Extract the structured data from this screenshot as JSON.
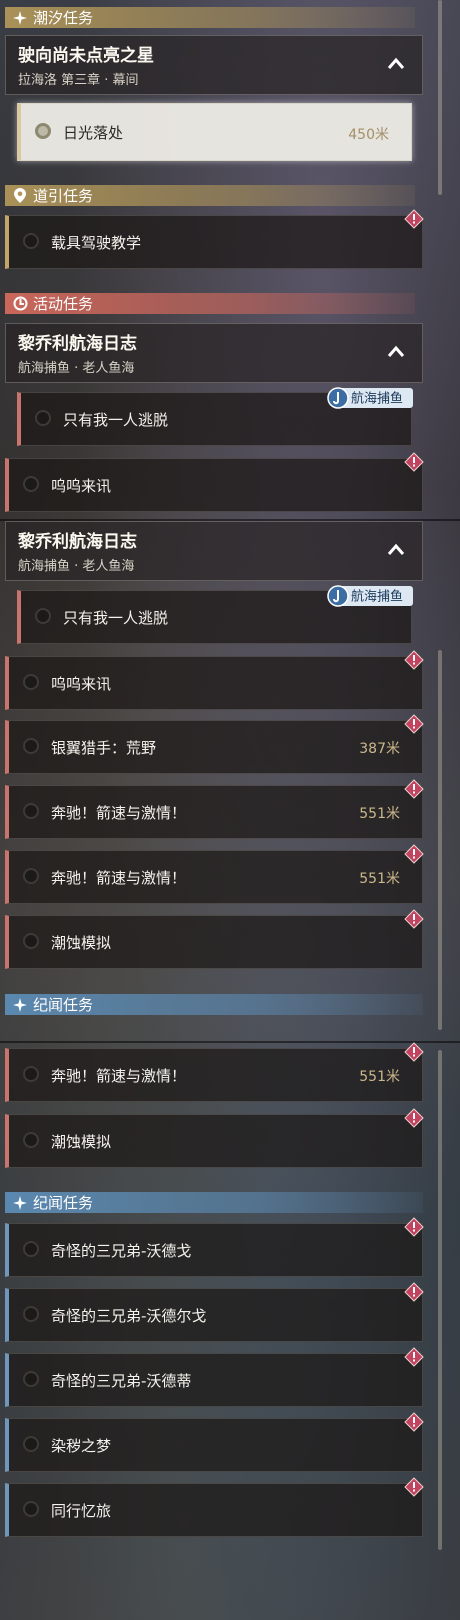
{
  "sections": {
    "tide": "潮汐任务",
    "guide": "道引任务",
    "event": "活动任务",
    "chronicle": "纪闻任务"
  },
  "tide_group": {
    "title": "驶向尚未点亮之星",
    "subtitle": "拉海洛 第三章 · 幕间"
  },
  "tide_quest": {
    "label": "日光落处",
    "distance": "450米"
  },
  "guide_quest": {
    "label": "载具驾驶教学"
  },
  "event_group": {
    "title": "黎乔利航海日志",
    "subtitle": "航海捕鱼 · 老人鱼海"
  },
  "fishing_tag": "航海捕鱼",
  "quests": {
    "escape": "只有我一人逃脱",
    "wuwu": "呜呜来讯",
    "silverwing": "银翼猎手：荒野",
    "gallop": "奔驰！箭速与激情！",
    "erosion": "潮蚀模拟",
    "brother1": "奇怪的三兄弟-沃德戈",
    "brother2": "奇怪的三兄弟-沃德尔戈",
    "brother3": "奇怪的三兄弟-沃德蒂",
    "dream": "染秽之梦",
    "companion": "同行忆旅"
  },
  "distances": {
    "silverwing": "387米",
    "gallop": "551米"
  },
  "colors": {
    "tide": "#b0965a",
    "event": "#cd685c",
    "chronicle": "#5c8ab2",
    "warn": "#c0435f"
  },
  "icons": {
    "sparkle": "sparkle-icon",
    "pin": "location-pin-icon",
    "event": "event-swirl-icon",
    "warn": "exclamation-diamond-icon",
    "chevron": "chevron-up-icon",
    "fish": "fishing-hook-icon"
  }
}
